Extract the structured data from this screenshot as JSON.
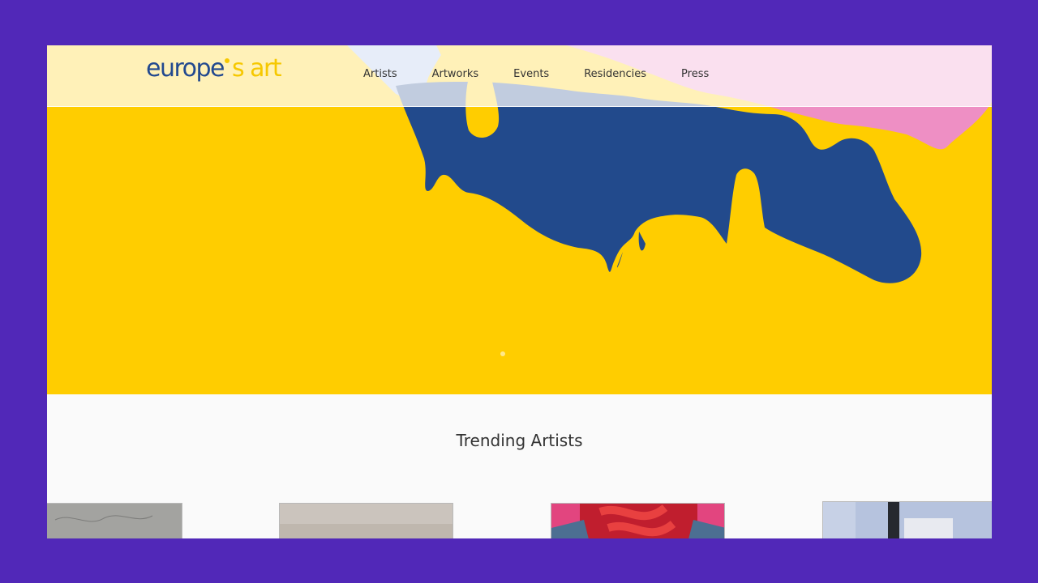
{
  "logo": {
    "word1": "europe",
    "word2": "s art"
  },
  "nav": {
    "items": [
      "Artists",
      "Artworks",
      "Events",
      "Residencies",
      "Press"
    ]
  },
  "hero": {
    "colors": {
      "yellow": "#ffcd00",
      "blue": "#224a8c",
      "pink": "#ee8fc4"
    }
  },
  "sections": {
    "trending_title": "Trending Artists"
  },
  "colors": {
    "background": "#5128b8",
    "logo_blue": "#22498f",
    "logo_yellow": "#f6c800"
  }
}
